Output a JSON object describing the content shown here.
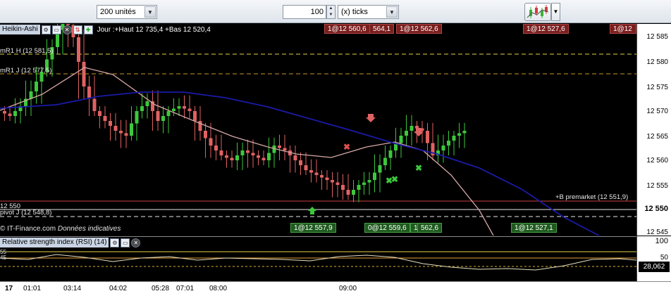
{
  "toolbar": {
    "units_select": "200 unités",
    "quantity": "100",
    "ticks_select": "(x) ticks",
    "chart_type_icon": "candlestick-chart-icon",
    "dropdown_icon": "chevron-down-icon"
  },
  "series": {
    "name": "Heikin-Ashi",
    "range": "Jour :+Haut 12 735,4 +Bas 12 520,4",
    "icons": [
      "wrench-icon",
      "window-icon",
      "close-icon",
      "sort-icon",
      "add-icon"
    ]
  },
  "levels": {
    "r1h": "mR1 H (12 581,5)",
    "r1j": "mR1 J (12 577,5)",
    "l12550": "12 550",
    "pivot": "pivot J (12 548,8)",
    "premarket": "+B premarket (12 551,9)"
  },
  "top_tags": [
    "1@12 560,6",
    "564,1",
    "1@12 562,6",
    "1@12 527,6",
    "1@12"
  ],
  "bottom_tags": [
    "1@12 557,9",
    "0@12 559,6",
    "1",
    "562,6",
    "1@12 527,1"
  ],
  "price_axis": {
    "labels": [
      "12 585",
      "12 580",
      "12 575",
      "12 570",
      "12 565",
      "12 560",
      "12 555",
      "12 550",
      "12 545",
      "100"
    ]
  },
  "credit": {
    "brand": "© IT-Finance.com",
    "note": "Données indicatives"
  },
  "rsi": {
    "title": "Relative strength index (RSI) (14)",
    "left_top": "55",
    "left_bottom": "45",
    "axis_50": "50",
    "value": "28,062"
  },
  "time_axis": [
    "17",
    "01:01",
    "03:14",
    "04:02",
    "05:28",
    "07:01",
    "08:00",
    "09:00"
  ],
  "colors": {
    "up": "#3cc83c",
    "down": "#e06262",
    "ma_fast": "#d8a8a8",
    "ma_slow": "#1a1aa8",
    "level_yellow": "#e6d24a",
    "level_red": "#c84040"
  }
}
